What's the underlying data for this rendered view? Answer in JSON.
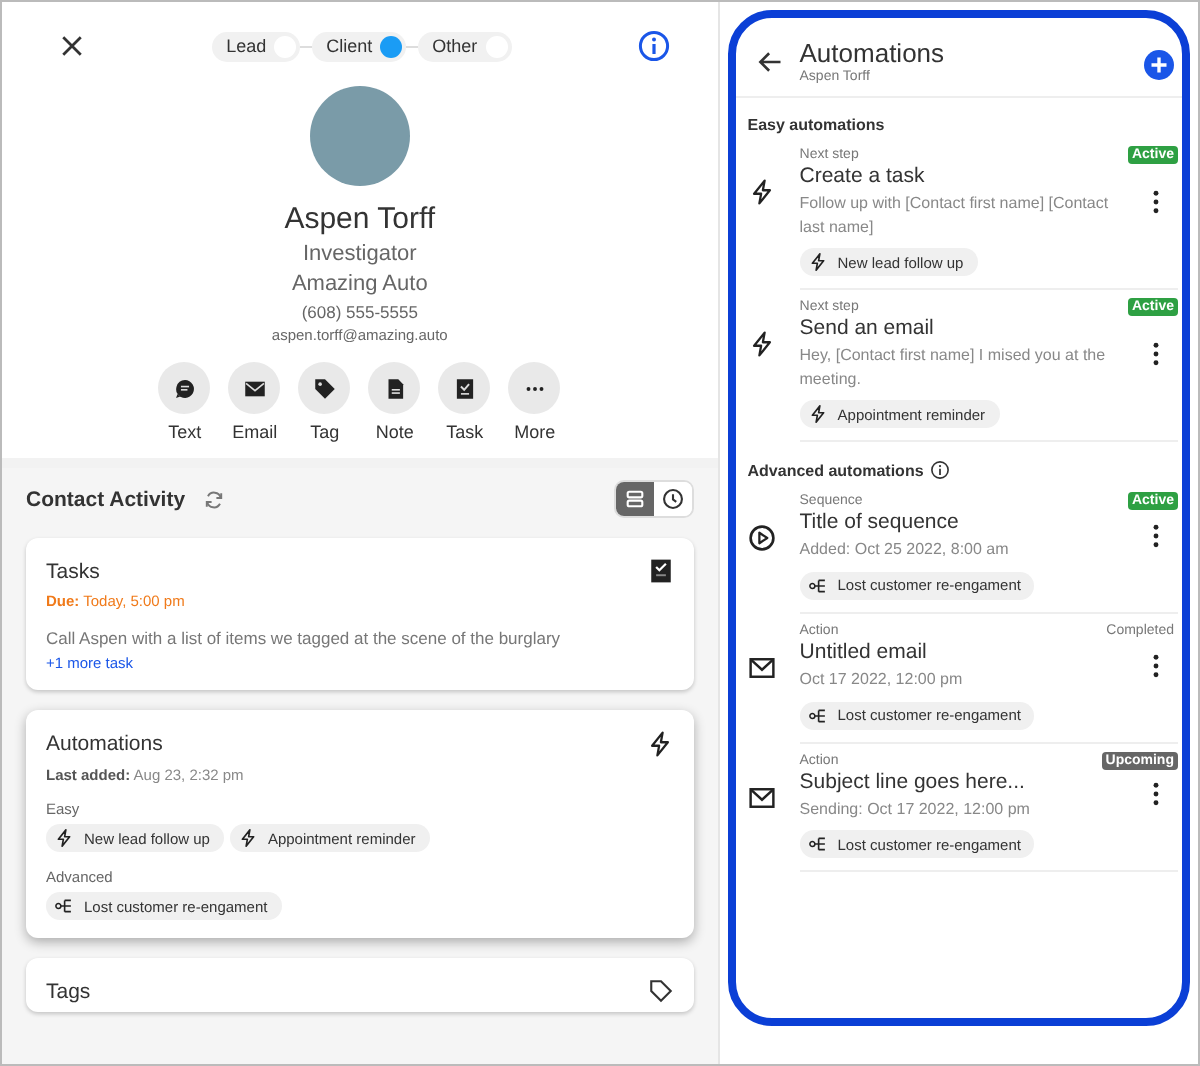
{
  "contact_types": [
    {
      "label": "Lead",
      "selected": false
    },
    {
      "label": "Client",
      "selected": true
    },
    {
      "label": "Other",
      "selected": false
    }
  ],
  "contact": {
    "name": "Aspen Torff",
    "title": "Investigator",
    "company": "Amazing Auto",
    "phone": "(608) 555-5555",
    "email": "aspen.torff@amazing.auto"
  },
  "actions": [
    {
      "kind": "text",
      "label": "Text"
    },
    {
      "kind": "email",
      "label": "Email"
    },
    {
      "kind": "tag",
      "label": "Tag"
    },
    {
      "kind": "note",
      "label": "Note"
    },
    {
      "kind": "task",
      "label": "Task"
    },
    {
      "kind": "more",
      "label": "More"
    }
  ],
  "activity": {
    "title": "Contact Activity",
    "views": [
      {
        "kind": "list",
        "selected": true
      },
      {
        "kind": "clock",
        "selected": false
      }
    ]
  },
  "tasks_card": {
    "title": "Tasks",
    "due_label": "Due:",
    "due": "Today, 5:00 pm",
    "description": "Call Aspen with a list of items we tagged at the scene of the burglary",
    "more": "+1 more task"
  },
  "automations_card": {
    "title": "Automations",
    "last_added_label": "Last added:",
    "last_added": "Aug 23, 2:32 pm",
    "groups": [
      {
        "label": "Easy",
        "chips": [
          {
            "kind": "bolt",
            "label": "New lead follow up"
          },
          {
            "kind": "bolt",
            "label": "Appointment reminder"
          }
        ]
      },
      {
        "label": "Advanced",
        "chips": [
          {
            "kind": "flow",
            "label": "Lost customer re-engament"
          }
        ]
      }
    ]
  },
  "tags_card": {
    "title": "Tags"
  },
  "panel": {
    "title": "Automations",
    "subtitle": "Aspen Torff",
    "sections": [
      {
        "title": "Easy automations",
        "info": false,
        "items": [
          {
            "kind": "bolt",
            "step": "Next step",
            "title": "Create a task",
            "detail": "Follow up with [Contact first name] [Contact last name]",
            "status": {
              "kind": "active",
              "label": "Active"
            },
            "chip": {
              "kind": "bolt",
              "label": "New lead follow up"
            }
          },
          {
            "kind": "bolt",
            "step": "Next step",
            "title": "Send an email",
            "detail": "Hey, [Contact first name] I mised you at the meeting.",
            "status": {
              "kind": "active",
              "label": "Active"
            },
            "chip": {
              "kind": "bolt",
              "label": "Appointment reminder"
            }
          }
        ]
      },
      {
        "title": "Advanced automations",
        "info": true,
        "items": [
          {
            "kind": "play",
            "step": "Sequence",
            "title": "Title of sequence",
            "detail": "Added: Oct 25 2022, 8:00 am",
            "status": {
              "kind": "active",
              "label": "Active"
            },
            "chip": {
              "kind": "flow",
              "label": "Lost customer re-engament"
            }
          },
          {
            "kind": "mail",
            "step": "Action",
            "title": "Untitled email",
            "detail": "Oct 17 2022, 12:00 pm",
            "status": {
              "kind": "completed",
              "label": "Completed"
            },
            "chip": {
              "kind": "flow",
              "label": "Lost customer re-engament"
            }
          },
          {
            "kind": "mail",
            "step": "Action",
            "title": "Subject line goes here...",
            "detail": "Sending: Oct 17 2022, 12:00 pm",
            "status": {
              "kind": "upcoming",
              "label": "Upcoming"
            },
            "chip": {
              "kind": "flow",
              "label": "Lost customer re-engament"
            }
          }
        ]
      }
    ]
  }
}
